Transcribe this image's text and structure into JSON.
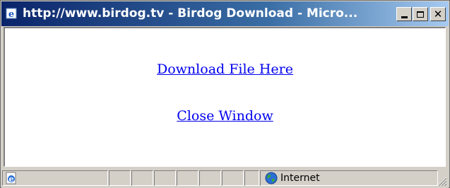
{
  "window": {
    "title": "http://www.birdog.tv - Birdog Download - Micro...",
    "title_color": "#ffffff",
    "titlebar_color": "#0a246a",
    "caption_buttons": {
      "minimize": "minimize-icon",
      "maximize": "maximize-icon",
      "close": "✕"
    }
  },
  "content": {
    "download_link": "Download File Here",
    "close_link": "Close Window",
    "link_color": "#0000ee"
  },
  "statusbar": {
    "page_icon": "ie-page-icon",
    "zone_icon": "globe-icon",
    "zone_label": "Internet"
  }
}
